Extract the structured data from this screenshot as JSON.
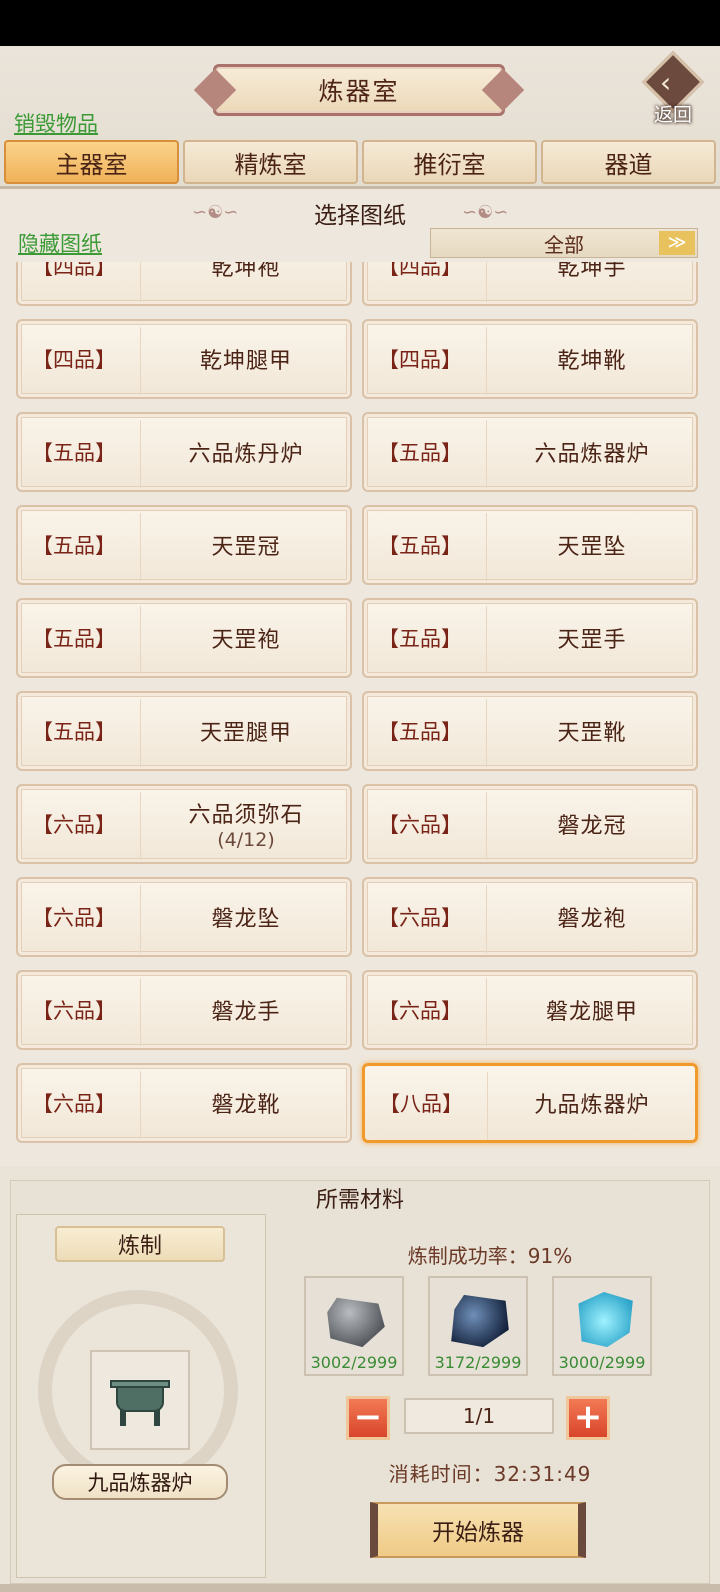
{
  "header": {
    "title": "炼器室",
    "back_label": "返回",
    "destroy_link": "销毁物品"
  },
  "tabs": [
    {
      "label": "主器室",
      "active": true
    },
    {
      "label": "精炼室",
      "active": false
    },
    {
      "label": "推衍室",
      "active": false
    },
    {
      "label": "器道",
      "active": false
    }
  ],
  "blueprints": {
    "title": "选择图纸",
    "hide_link": "隐藏图纸",
    "filter": "全部",
    "items": [
      {
        "grade": "【四品】",
        "name": "乾坤袍",
        "sub": ""
      },
      {
        "grade": "【四品】",
        "name": "乾坤手",
        "sub": ""
      },
      {
        "grade": "【四品】",
        "name": "乾坤腿甲",
        "sub": ""
      },
      {
        "grade": "【四品】",
        "name": "乾坤靴",
        "sub": ""
      },
      {
        "grade": "【五品】",
        "name": "六品炼丹炉",
        "sub": ""
      },
      {
        "grade": "【五品】",
        "name": "六品炼器炉",
        "sub": ""
      },
      {
        "grade": "【五品】",
        "name": "天罡冠",
        "sub": ""
      },
      {
        "grade": "【五品】",
        "name": "天罡坠",
        "sub": ""
      },
      {
        "grade": "【五品】",
        "name": "天罡袍",
        "sub": ""
      },
      {
        "grade": "【五品】",
        "name": "天罡手",
        "sub": ""
      },
      {
        "grade": "【五品】",
        "name": "天罡腿甲",
        "sub": ""
      },
      {
        "grade": "【五品】",
        "name": "天罡靴",
        "sub": ""
      },
      {
        "grade": "【六品】",
        "name": "六品须弥石",
        "sub": "(4/12)"
      },
      {
        "grade": "【六品】",
        "name": "磐龙冠",
        "sub": ""
      },
      {
        "grade": "【六品】",
        "name": "磐龙坠",
        "sub": ""
      },
      {
        "grade": "【六品】",
        "name": "磐龙袍",
        "sub": ""
      },
      {
        "grade": "【六品】",
        "name": "磐龙手",
        "sub": ""
      },
      {
        "grade": "【六品】",
        "name": "磐龙腿甲",
        "sub": ""
      },
      {
        "grade": "【六品】",
        "name": "磐龙靴",
        "sub": ""
      },
      {
        "grade": "【八品】",
        "name": "九品炼器炉",
        "sub": "",
        "selected": true
      }
    ]
  },
  "materials": {
    "title": "所需材料",
    "craft_label": "炼制",
    "item_name": "九品炼器炉",
    "success_rate": "炼制成功率：91%",
    "slots": [
      {
        "icon": "grey-ore-icon",
        "count": "3002/2999"
      },
      {
        "icon": "dark-crystal-icon",
        "count": "3172/2999"
      },
      {
        "icon": "cyan-crystal-icon",
        "count": "3000/2999"
      }
    ],
    "minus": "−",
    "plus": "+",
    "quantity": "1/1",
    "time": "消耗时间：32:31:49",
    "start_button": "开始炼器"
  }
}
